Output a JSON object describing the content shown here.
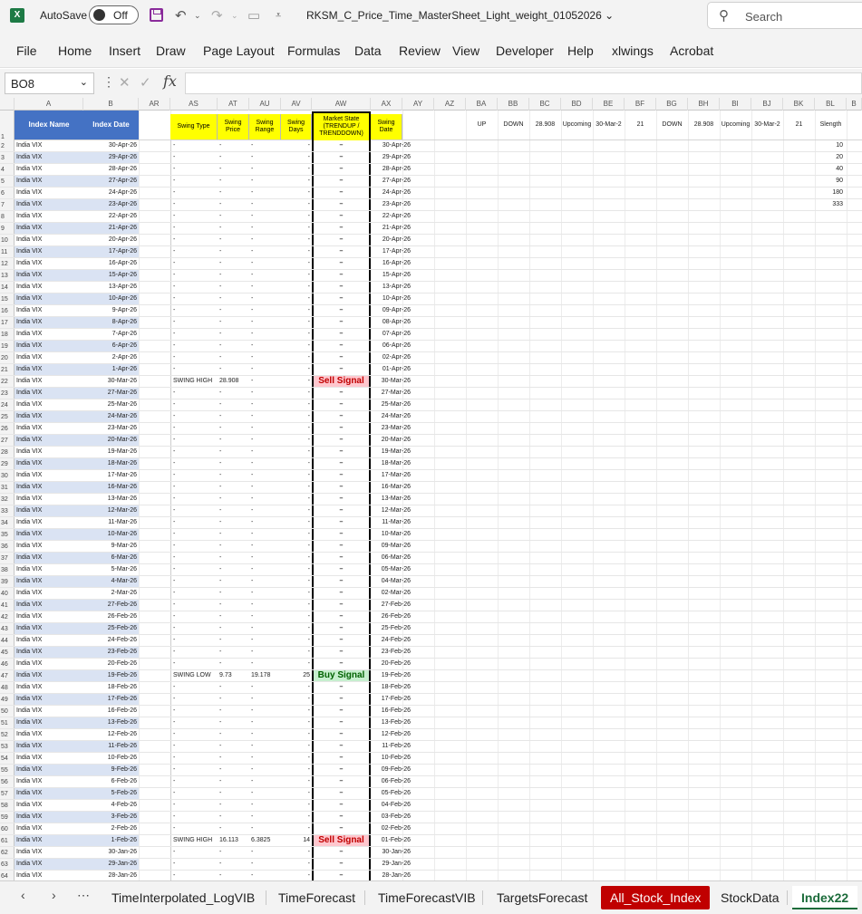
{
  "titlebar": {
    "autosave_label": "AutoSave",
    "toggle_label": "Off",
    "doc_title": "RKSM_C_Price_Time_MasterSheet_Light_weight_01052026",
    "search_placeholder": "Search"
  },
  "menu": [
    "File",
    "Home",
    "Insert",
    "Draw",
    "Page Layout",
    "Formulas",
    "Data",
    "Review",
    "View",
    "Developer",
    "Help",
    "xlwings",
    "Acrobat"
  ],
  "formula_bar": {
    "namebox": "BO8",
    "formula": ""
  },
  "columns": [
    "A",
    "B",
    "AR",
    "AS",
    "AT",
    "AU",
    "AV",
    "AW",
    "AX",
    "AY",
    "AZ",
    "BA",
    "BB",
    "BC",
    "BD",
    "BE",
    "BF",
    "BG",
    "BH",
    "BI",
    "BJ",
    "BK",
    "BL",
    "B"
  ],
  "header_row": {
    "index_name": "Index Name",
    "index_date": "Index Date",
    "swing_type": "Swing Type",
    "swing_price": "Swing Price",
    "swing_range": "Swing Range",
    "swing_days": "Swing Days",
    "market_state": "Market State (TRENDUP / TRENDDOWN)",
    "swing_date": "Swing Date",
    "ba": "UP",
    "bb": "DOWN",
    "bc": "28.908",
    "bd": "Upcoming",
    "be": "30-Mar-2",
    "bf": "21",
    "bg": "DOWN",
    "bh": "28.908",
    "bi": "Upcoming",
    "bj": "30-Mar-2",
    "bk": "21",
    "bl": "Slength"
  },
  "rows": [
    {
      "n": "2",
      "a": "India VIX",
      "b": "30-Apr-26",
      "as": "-",
      "at": "-",
      "au": "-",
      "av": "-",
      "aw": "–",
      "ax": "30-Apr-26",
      "bl": "10"
    },
    {
      "n": "3",
      "a": "India VIX",
      "b": "29-Apr-26",
      "as": "-",
      "at": "-",
      "au": "-",
      "av": "-",
      "aw": "–",
      "ax": "29-Apr-26",
      "bl": "20"
    },
    {
      "n": "4",
      "a": "India VIX",
      "b": "28-Apr-26",
      "as": "-",
      "at": "-",
      "au": "-",
      "av": "-",
      "aw": "–",
      "ax": "28-Apr-26",
      "bl": "40"
    },
    {
      "n": "5",
      "a": "India VIX",
      "b": "27-Apr-26",
      "as": "-",
      "at": "-",
      "au": "-",
      "av": "-",
      "aw": "–",
      "ax": "27-Apr-26",
      "bl": "90"
    },
    {
      "n": "6",
      "a": "India VIX",
      "b": "24-Apr-26",
      "as": "-",
      "at": "-",
      "au": "-",
      "av": "-",
      "aw": "–",
      "ax": "24-Apr-26",
      "bl": "180"
    },
    {
      "n": "7",
      "a": "India VIX",
      "b": "23-Apr-26",
      "as": "-",
      "at": "-",
      "au": "-",
      "av": "-",
      "aw": "–",
      "ax": "23-Apr-26",
      "bl": "333"
    },
    {
      "n": "8",
      "a": "India VIX",
      "b": "22-Apr-26",
      "as": "-",
      "at": "-",
      "au": "-",
      "av": "-",
      "aw": "–",
      "ax": "22-Apr-26",
      "bl": ""
    },
    {
      "n": "9",
      "a": "India VIX",
      "b": "21-Apr-26",
      "as": "-",
      "at": "-",
      "au": "-",
      "av": "-",
      "aw": "–",
      "ax": "21-Apr-26",
      "bl": ""
    },
    {
      "n": "10",
      "a": "India VIX",
      "b": "20-Apr-26",
      "as": "-",
      "at": "-",
      "au": "-",
      "av": "-",
      "aw": "–",
      "ax": "20-Apr-26",
      "bl": ""
    },
    {
      "n": "11",
      "a": "India VIX",
      "b": "17-Apr-26",
      "as": "-",
      "at": "-",
      "au": "-",
      "av": "-",
      "aw": "–",
      "ax": "17-Apr-26",
      "bl": ""
    },
    {
      "n": "12",
      "a": "India VIX",
      "b": "16-Apr-26",
      "as": "-",
      "at": "-",
      "au": "-",
      "av": "-",
      "aw": "–",
      "ax": "16-Apr-26",
      "bl": ""
    },
    {
      "n": "13",
      "a": "India VIX",
      "b": "15-Apr-26",
      "as": "-",
      "at": "-",
      "au": "-",
      "av": "-",
      "aw": "–",
      "ax": "15-Apr-26",
      "bl": ""
    },
    {
      "n": "14",
      "a": "India VIX",
      "b": "13-Apr-26",
      "as": "-",
      "at": "-",
      "au": "-",
      "av": "-",
      "aw": "–",
      "ax": "13-Apr-26",
      "bl": ""
    },
    {
      "n": "15",
      "a": "India VIX",
      "b": "10-Apr-26",
      "as": "-",
      "at": "-",
      "au": "-",
      "av": "-",
      "aw": "–",
      "ax": "10-Apr-26",
      "bl": ""
    },
    {
      "n": "16",
      "a": "India VIX",
      "b": "9-Apr-26",
      "as": "-",
      "at": "-",
      "au": "-",
      "av": "-",
      "aw": "–",
      "ax": "09-Apr-26",
      "bl": ""
    },
    {
      "n": "17",
      "a": "India VIX",
      "b": "8-Apr-26",
      "as": "-",
      "at": "-",
      "au": "-",
      "av": "-",
      "aw": "–",
      "ax": "08-Apr-26",
      "bl": ""
    },
    {
      "n": "18",
      "a": "India VIX",
      "b": "7-Apr-26",
      "as": "-",
      "at": "-",
      "au": "-",
      "av": "-",
      "aw": "–",
      "ax": "07-Apr-26",
      "bl": ""
    },
    {
      "n": "19",
      "a": "India VIX",
      "b": "6-Apr-26",
      "as": "-",
      "at": "-",
      "au": "-",
      "av": "-",
      "aw": "–",
      "ax": "06-Apr-26",
      "bl": ""
    },
    {
      "n": "20",
      "a": "India VIX",
      "b": "2-Apr-26",
      "as": "-",
      "at": "-",
      "au": "-",
      "av": "-",
      "aw": "–",
      "ax": "02-Apr-26",
      "bl": ""
    },
    {
      "n": "21",
      "a": "India VIX",
      "b": "1-Apr-26",
      "as": "-",
      "at": "-",
      "au": "-",
      "av": "-",
      "aw": "–",
      "ax": "01-Apr-26",
      "bl": ""
    },
    {
      "n": "22",
      "a": "India VIX",
      "b": "30-Mar-26",
      "as": "SWING HIGH",
      "at": "28.908",
      "au": "-",
      "av": "-",
      "aw": "Sell Signal",
      "ax": "30-Mar-26",
      "bl": ""
    },
    {
      "n": "23",
      "a": "India VIX",
      "b": "27-Mar-26",
      "as": "-",
      "at": "-",
      "au": "-",
      "av": "-",
      "aw": "–",
      "ax": "27-Mar-26",
      "bl": ""
    },
    {
      "n": "24",
      "a": "India VIX",
      "b": "25-Mar-26",
      "as": "-",
      "at": "-",
      "au": "-",
      "av": "-",
      "aw": "–",
      "ax": "25-Mar-26",
      "bl": ""
    },
    {
      "n": "25",
      "a": "India VIX",
      "b": "24-Mar-26",
      "as": "-",
      "at": "-",
      "au": "-",
      "av": "-",
      "aw": "–",
      "ax": "24-Mar-26",
      "bl": ""
    },
    {
      "n": "26",
      "a": "India VIX",
      "b": "23-Mar-26",
      "as": "-",
      "at": "-",
      "au": "-",
      "av": "-",
      "aw": "–",
      "ax": "23-Mar-26",
      "bl": ""
    },
    {
      "n": "27",
      "a": "India VIX",
      "b": "20-Mar-26",
      "as": "-",
      "at": "-",
      "au": "-",
      "av": "-",
      "aw": "–",
      "ax": "20-Mar-26",
      "bl": ""
    },
    {
      "n": "28",
      "a": "India VIX",
      "b": "19-Mar-26",
      "as": "-",
      "at": "-",
      "au": "-",
      "av": "-",
      "aw": "–",
      "ax": "19-Mar-26",
      "bl": ""
    },
    {
      "n": "29",
      "a": "India VIX",
      "b": "18-Mar-26",
      "as": "-",
      "at": "-",
      "au": "-",
      "av": "-",
      "aw": "–",
      "ax": "18-Mar-26",
      "bl": ""
    },
    {
      "n": "30",
      "a": "India VIX",
      "b": "17-Mar-26",
      "as": "-",
      "at": "-",
      "au": "-",
      "av": "-",
      "aw": "–",
      "ax": "17-Mar-26",
      "bl": ""
    },
    {
      "n": "31",
      "a": "India VIX",
      "b": "16-Mar-26",
      "as": "-",
      "at": "-",
      "au": "-",
      "av": "-",
      "aw": "–",
      "ax": "16-Mar-26",
      "bl": ""
    },
    {
      "n": "32",
      "a": "India VIX",
      "b": "13-Mar-26",
      "as": "-",
      "at": "-",
      "au": "-",
      "av": "-",
      "aw": "–",
      "ax": "13-Mar-26",
      "bl": ""
    },
    {
      "n": "33",
      "a": "India VIX",
      "b": "12-Mar-26",
      "as": "-",
      "at": "-",
      "au": "-",
      "av": "-",
      "aw": "–",
      "ax": "12-Mar-26",
      "bl": ""
    },
    {
      "n": "34",
      "a": "India VIX",
      "b": "11-Mar-26",
      "as": "-",
      "at": "-",
      "au": "-",
      "av": "-",
      "aw": "–",
      "ax": "11-Mar-26",
      "bl": ""
    },
    {
      "n": "35",
      "a": "India VIX",
      "b": "10-Mar-26",
      "as": "-",
      "at": "-",
      "au": "-",
      "av": "-",
      "aw": "–",
      "ax": "10-Mar-26",
      "bl": ""
    },
    {
      "n": "36",
      "a": "India VIX",
      "b": "9-Mar-26",
      "as": "-",
      "at": "-",
      "au": "-",
      "av": "-",
      "aw": "–",
      "ax": "09-Mar-26",
      "bl": ""
    },
    {
      "n": "37",
      "a": "India VIX",
      "b": "6-Mar-26",
      "as": "-",
      "at": "-",
      "au": "-",
      "av": "-",
      "aw": "–",
      "ax": "06-Mar-26",
      "bl": ""
    },
    {
      "n": "38",
      "a": "India VIX",
      "b": "5-Mar-26",
      "as": "-",
      "at": "-",
      "au": "-",
      "av": "-",
      "aw": "–",
      "ax": "05-Mar-26",
      "bl": ""
    },
    {
      "n": "39",
      "a": "India VIX",
      "b": "4-Mar-26",
      "as": "-",
      "at": "-",
      "au": "-",
      "av": "-",
      "aw": "–",
      "ax": "04-Mar-26",
      "bl": ""
    },
    {
      "n": "40",
      "a": "India VIX",
      "b": "2-Mar-26",
      "as": "-",
      "at": "-",
      "au": "-",
      "av": "-",
      "aw": "–",
      "ax": "02-Mar-26",
      "bl": ""
    },
    {
      "n": "41",
      "a": "India VIX",
      "b": "27-Feb-26",
      "as": "-",
      "at": "-",
      "au": "-",
      "av": "-",
      "aw": "–",
      "ax": "27-Feb-26",
      "bl": ""
    },
    {
      "n": "42",
      "a": "India VIX",
      "b": "26-Feb-26",
      "as": "-",
      "at": "-",
      "au": "-",
      "av": "-",
      "aw": "–",
      "ax": "26-Feb-26",
      "bl": ""
    },
    {
      "n": "43",
      "a": "India VIX",
      "b": "25-Feb-26",
      "as": "-",
      "at": "-",
      "au": "-",
      "av": "-",
      "aw": "–",
      "ax": "25-Feb-26",
      "bl": ""
    },
    {
      "n": "44",
      "a": "India VIX",
      "b": "24-Feb-26",
      "as": "-",
      "at": "-",
      "au": "-",
      "av": "-",
      "aw": "–",
      "ax": "24-Feb-26",
      "bl": ""
    },
    {
      "n": "45",
      "a": "India VIX",
      "b": "23-Feb-26",
      "as": "-",
      "at": "-",
      "au": "-",
      "av": "-",
      "aw": "–",
      "ax": "23-Feb-26",
      "bl": ""
    },
    {
      "n": "46",
      "a": "India VIX",
      "b": "20-Feb-26",
      "as": "-",
      "at": "-",
      "au": "-",
      "av": "-",
      "aw": "–",
      "ax": "20-Feb-26",
      "bl": ""
    },
    {
      "n": "47",
      "a": "India VIX",
      "b": "19-Feb-26",
      "as": "SWING LOW",
      "at": "9.73",
      "au": "19.178",
      "av": "25",
      "aw": "Buy Signal",
      "ax": "19-Feb-26",
      "bl": ""
    },
    {
      "n": "48",
      "a": "India VIX",
      "b": "18-Feb-26",
      "as": "-",
      "at": "-",
      "au": "-",
      "av": "-",
      "aw": "–",
      "ax": "18-Feb-26",
      "bl": ""
    },
    {
      "n": "49",
      "a": "India VIX",
      "b": "17-Feb-26",
      "as": "-",
      "at": "-",
      "au": "-",
      "av": "-",
      "aw": "–",
      "ax": "17-Feb-26",
      "bl": ""
    },
    {
      "n": "50",
      "a": "India VIX",
      "b": "16-Feb-26",
      "as": "-",
      "at": "-",
      "au": "-",
      "av": "-",
      "aw": "–",
      "ax": "16-Feb-26",
      "bl": ""
    },
    {
      "n": "51",
      "a": "India VIX",
      "b": "13-Feb-26",
      "as": "-",
      "at": "-",
      "au": "-",
      "av": "-",
      "aw": "–",
      "ax": "13-Feb-26",
      "bl": ""
    },
    {
      "n": "52",
      "a": "India VIX",
      "b": "12-Feb-26",
      "as": "-",
      "at": "-",
      "au": "-",
      "av": "-",
      "aw": "–",
      "ax": "12-Feb-26",
      "bl": ""
    },
    {
      "n": "53",
      "a": "India VIX",
      "b": "11-Feb-26",
      "as": "-",
      "at": "-",
      "au": "-",
      "av": "-",
      "aw": "–",
      "ax": "11-Feb-26",
      "bl": ""
    },
    {
      "n": "54",
      "a": "India VIX",
      "b": "10-Feb-26",
      "as": "-",
      "at": "-",
      "au": "-",
      "av": "-",
      "aw": "–",
      "ax": "10-Feb-26",
      "bl": ""
    },
    {
      "n": "55",
      "a": "India VIX",
      "b": "9-Feb-26",
      "as": "-",
      "at": "-",
      "au": "-",
      "av": "-",
      "aw": "–",
      "ax": "09-Feb-26",
      "bl": ""
    },
    {
      "n": "56",
      "a": "India VIX",
      "b": "6-Feb-26",
      "as": "-",
      "at": "-",
      "au": "-",
      "av": "-",
      "aw": "–",
      "ax": "06-Feb-26",
      "bl": ""
    },
    {
      "n": "57",
      "a": "India VIX",
      "b": "5-Feb-26",
      "as": "-",
      "at": "-",
      "au": "-",
      "av": "-",
      "aw": "–",
      "ax": "05-Feb-26",
      "bl": ""
    },
    {
      "n": "58",
      "a": "India VIX",
      "b": "4-Feb-26",
      "as": "-",
      "at": "-",
      "au": "-",
      "av": "-",
      "aw": "–",
      "ax": "04-Feb-26",
      "bl": ""
    },
    {
      "n": "59",
      "a": "India VIX",
      "b": "3-Feb-26",
      "as": "-",
      "at": "-",
      "au": "-",
      "av": "-",
      "aw": "–",
      "ax": "03-Feb-26",
      "bl": ""
    },
    {
      "n": "60",
      "a": "India VIX",
      "b": "2-Feb-26",
      "as": "-",
      "at": "-",
      "au": "-",
      "av": "-",
      "aw": "–",
      "ax": "02-Feb-26",
      "bl": ""
    },
    {
      "n": "61",
      "a": "India VIX",
      "b": "1-Feb-26",
      "as": "SWING HIGH",
      "at": "16.113",
      "au": "6.3825",
      "av": "14",
      "aw": "Sell Signal",
      "ax": "01-Feb-26",
      "bl": ""
    },
    {
      "n": "62",
      "a": "India VIX",
      "b": "30-Jan-26",
      "as": "-",
      "at": "-",
      "au": "-",
      "av": "-",
      "aw": "–",
      "ax": "30-Jan-26",
      "bl": ""
    },
    {
      "n": "63",
      "a": "India VIX",
      "b": "29-Jan-26",
      "as": "-",
      "at": "-",
      "au": "-",
      "av": "-",
      "aw": "–",
      "ax": "29-Jan-26",
      "bl": ""
    },
    {
      "n": "64",
      "a": "India VIX",
      "b": "28-Jan-26",
      "as": "-",
      "at": "-",
      "au": "-",
      "av": "-",
      "aw": "–",
      "ax": "28-Jan-26",
      "bl": ""
    }
  ],
  "sheet_tabs": [
    "TimeInterpolated_LogVIB",
    "TimeForecast",
    "TimeForecastVIB",
    "TargetsForecast",
    "All_Stock_Index",
    "StockData",
    "Index22"
  ],
  "colors": {
    "header_blue": "#4472c4",
    "header_yellow": "#ffff00",
    "sell": "#c00000",
    "buy": "#006100",
    "accent_green": "#1b6b3a"
  }
}
